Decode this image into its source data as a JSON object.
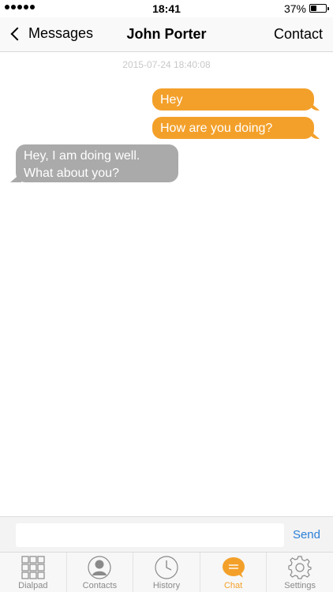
{
  "status_bar": {
    "time": "18:41",
    "battery": "37%",
    "battery_level": 0.37
  },
  "nav": {
    "back_label": "Messages",
    "title": "John Porter",
    "right_label": "Contact"
  },
  "chat": {
    "timestamp": "2015-07-24 18:40:08",
    "messages": [
      {
        "direction": "out",
        "text": "Hey"
      },
      {
        "direction": "out",
        "text": "How are you doing?"
      },
      {
        "direction": "in",
        "text": "Hey, I am doing well. What about you?"
      }
    ]
  },
  "composer": {
    "input_value": "",
    "send_label": "Send"
  },
  "tabs": [
    {
      "label": "Dialpad",
      "icon": "dialpad-icon",
      "active": false
    },
    {
      "label": "Contacts",
      "icon": "contacts-icon",
      "active": false
    },
    {
      "label": "History",
      "icon": "history-icon",
      "active": false
    },
    {
      "label": "Chat",
      "icon": "chat-icon",
      "active": true
    },
    {
      "label": "Settings",
      "icon": "settings-icon",
      "active": false
    }
  ],
  "colors": {
    "accent": "#f3a02a",
    "incoming": "#aaaaaa",
    "link": "#2b7fd8"
  }
}
